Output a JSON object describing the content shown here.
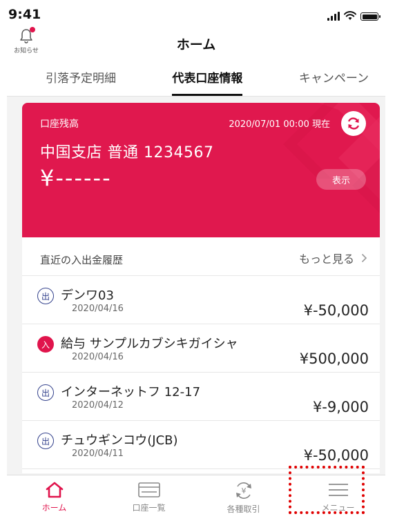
{
  "status_bar": {
    "time": "9:41"
  },
  "header": {
    "notice_label": "お知らせ",
    "title": "ホーム",
    "tabs": [
      {
        "label": "引落予定明細",
        "active": false
      },
      {
        "label": "代表口座情報",
        "active": true
      },
      {
        "label": "キャンペーン",
        "active": false
      }
    ]
  },
  "account_card": {
    "balance_label": "口座残高",
    "as_of": "2020/07/01 00:00 現在",
    "account_name": "中国支店 普通 1234567",
    "balance": "¥------",
    "show_button": "表示",
    "colors": {
      "card": "#e0184e"
    }
  },
  "history": {
    "title": "直近の入出金履歴",
    "more_label": "もっと見る",
    "rows": [
      {
        "type_label": "出",
        "type": "out",
        "name": "デンワ03",
        "date": "2020/04/16",
        "amount": "¥-50,000"
      },
      {
        "type_label": "入",
        "type": "in",
        "name": "給与 サンプルカブシキガイシャ",
        "date": "2020/04/16",
        "amount": "¥500,000"
      },
      {
        "type_label": "出",
        "type": "out",
        "name": "インターネットフ 12-17",
        "date": "2020/04/12",
        "amount": "¥-9,000"
      },
      {
        "type_label": "出",
        "type": "out",
        "name": "チュウギンコウ(JCB)",
        "date": "2020/04/11",
        "amount": "¥-50,000"
      }
    ]
  },
  "bottom_nav": {
    "items": [
      {
        "label": "ホーム",
        "icon": "home-icon",
        "active": true
      },
      {
        "label": "口座一覧",
        "icon": "card-icon",
        "active": false
      },
      {
        "label": "各種取引",
        "icon": "exchange-icon",
        "active": false
      },
      {
        "label": "メニュー",
        "icon": "menu-icon",
        "active": false
      }
    ]
  },
  "accent_color": "#e0144c"
}
